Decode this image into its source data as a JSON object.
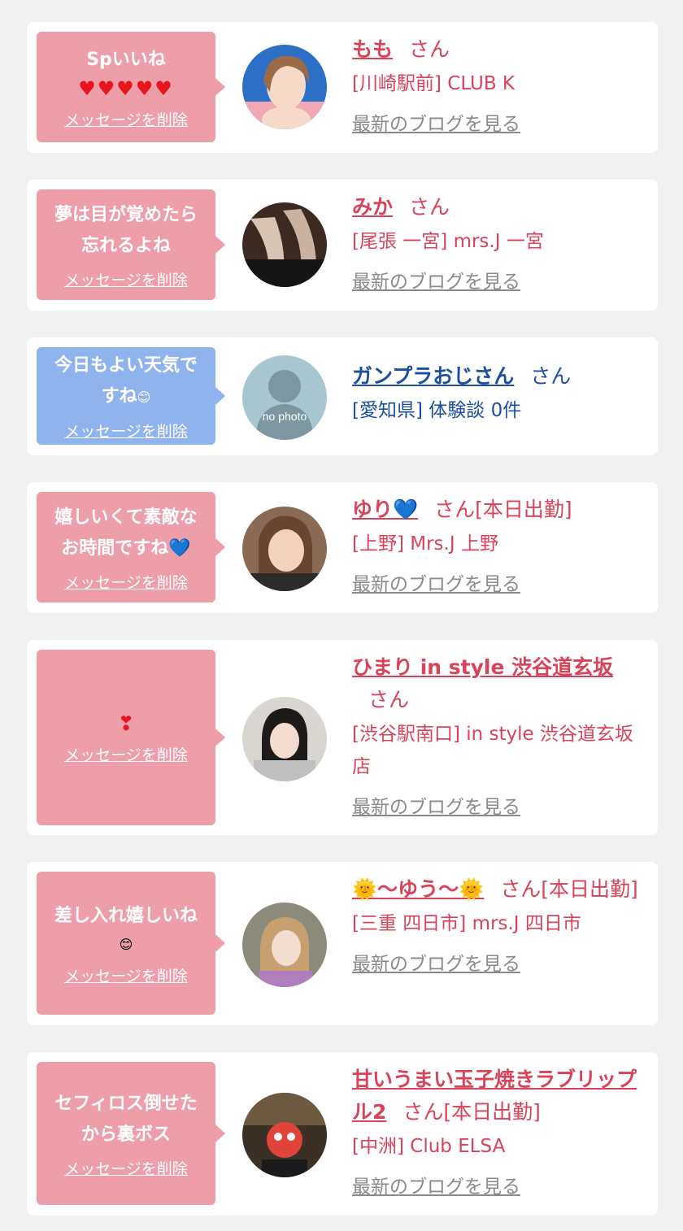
{
  "cards": [
    {
      "message": "Spいいね",
      "icons": "♥♥♥♥♥",
      "delete_label": "メッセージを削除",
      "name": "もも",
      "san": "さん",
      "shop": "[川崎駅前] CLUB K",
      "blog_link": "最新のブログを見る"
    },
    {
      "message": "夢は目が覚めたら\n忘れるよね",
      "delete_label": "メッセージを削除",
      "name": "みか",
      "san": "さん",
      "shop": "[尾張 一宮] mrs.J 一宮",
      "blog_link": "最新のブログを見る"
    },
    {
      "message": "今日もよい天気で\nすね",
      "emoji": "😊",
      "delete_label": "メッセージを削除",
      "name": "ガンプラおじさん",
      "san": "さん",
      "shop": "[愛知県] 体験談 0件",
      "avatar_text": "no photo"
    },
    {
      "message": "嬉しいくて素敵な\nお時間ですね",
      "emoji": "💙",
      "delete_label": "メッセージを削除",
      "name": "ゆり",
      "name_emoji": "💙",
      "san": "さん[本日出勤]",
      "shop": "[上野] Mrs.J 上野",
      "blog_link": "最新のブログを見る"
    },
    {
      "message": "",
      "emoji": "❣",
      "delete_label": "メッセージを削除",
      "name": "ひまり in style 渋谷道玄坂",
      "san": "さん",
      "shop": "[渋谷駅南口] in style 渋谷道玄坂店",
      "blog_link": "最新のブログを見る"
    },
    {
      "message": "差し入れ嬉しいね",
      "emoji": "😊",
      "delete_label": "メッセージを削除",
      "name": "〜ゆう〜",
      "name_emoji": "🌞",
      "san": "さん[本日出勤]",
      "shop": "[三重 四日市] mrs.J 四日市",
      "blog_link": "最新のブログを見る"
    },
    {
      "message": "セフィロス倒せた\nから裏ボス",
      "delete_label": "メッセージを削除",
      "name": "甘いうまい玉子焼きラブリップル2",
      "san": "さん[本日出勤]",
      "shop": "[中洲] Club ELSA",
      "blog_link": "最新のブログを見る"
    }
  ],
  "colors": {
    "accent_pink": "#d8435a",
    "bubble_pink": "#ed9ea8",
    "bubble_blue": "#8fb3ec",
    "link_blue": "#1c4f9f",
    "background": "#f1f1f1"
  }
}
